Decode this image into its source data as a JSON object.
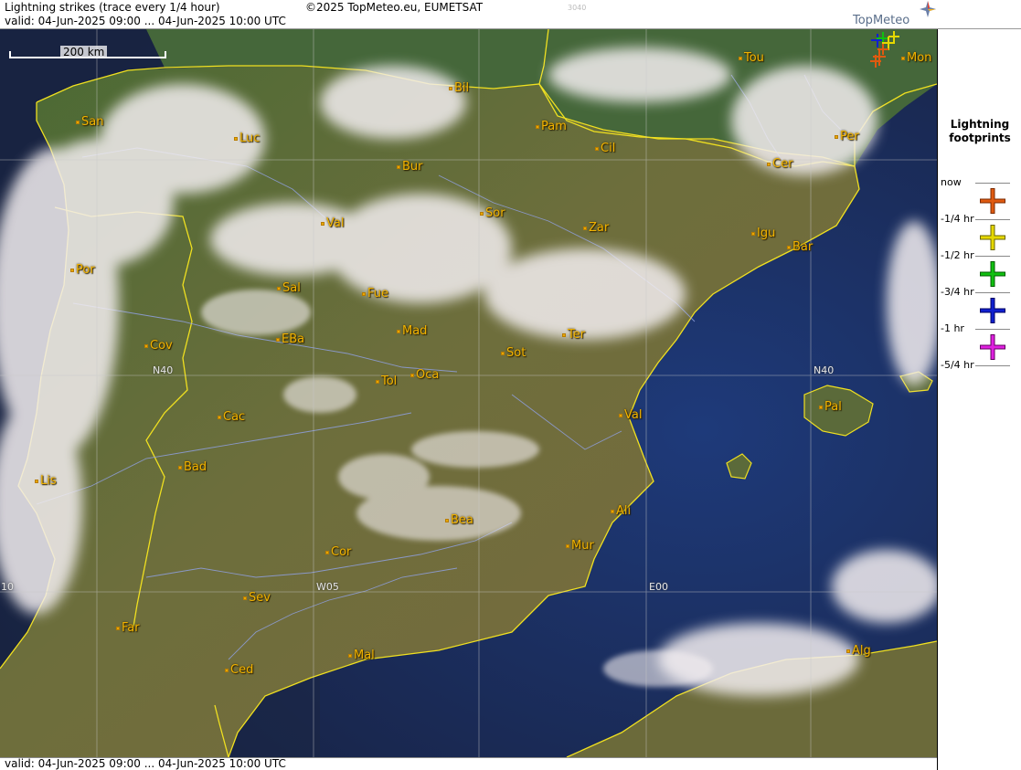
{
  "header": {
    "title": "Lightning strikes (trace every 1/4 hour)",
    "valid": "valid:  04-Jun-2025 09:00 ... 04-Jun-2025 10:00 UTC",
    "copyright": "©2025 TopMeteo.eu, EUMETSAT",
    "code": "3040",
    "logo_text": "TopMeteo"
  },
  "footer": {
    "valid": "valid:  04-Jun-2025 09:00 ... 04-Jun-2025 10:00 UTC"
  },
  "map": {
    "scale_label": "200 km",
    "grid_labels": {
      "n40_left": "N40",
      "n40_right": "N40",
      "w10": "10",
      "w05": "W05",
      "e00": "E00"
    },
    "cities": [
      {
        "name": "Tou"
      },
      {
        "name": "Mon"
      },
      {
        "name": "Bil"
      },
      {
        "name": "San"
      },
      {
        "name": "Pam"
      },
      {
        "name": "Luc"
      },
      {
        "name": "Cil"
      },
      {
        "name": "Per"
      },
      {
        "name": "Bur"
      },
      {
        "name": "Cer"
      },
      {
        "name": "Sor"
      },
      {
        "name": "Val"
      },
      {
        "name": "Zar"
      },
      {
        "name": "Igu"
      },
      {
        "name": "Bar"
      },
      {
        "name": "Por"
      },
      {
        "name": "Sal"
      },
      {
        "name": "Fue"
      },
      {
        "name": "Mad"
      },
      {
        "name": "Ter"
      },
      {
        "name": "Cov"
      },
      {
        "name": "EBa"
      },
      {
        "name": "Sot"
      },
      {
        "name": "Tol"
      },
      {
        "name": "Oca"
      },
      {
        "name": "Pal"
      },
      {
        "name": "Cac"
      },
      {
        "name": "Val"
      },
      {
        "name": "Bad"
      },
      {
        "name": "Lis"
      },
      {
        "name": "Ali"
      },
      {
        "name": "Bea"
      },
      {
        "name": "Mur"
      },
      {
        "name": "Cor"
      },
      {
        "name": "Sev"
      },
      {
        "name": "Far"
      },
      {
        "name": "Alg"
      },
      {
        "name": "Ced"
      },
      {
        "name": "Mal"
      }
    ]
  },
  "legend": {
    "title_line1": "Lightning",
    "title_line2": "footprints",
    "rows": [
      {
        "label": "now",
        "color": "#e05a10"
      },
      {
        "label": "-1/4 hr",
        "color": "#e6d800"
      },
      {
        "label": "-1/2 hr",
        "color": "#10c010"
      },
      {
        "label": "-3/4 hr",
        "color": "#1020d0"
      },
      {
        "label": "-1 hr",
        "color": "#e020e0"
      },
      {
        "label": "-5/4 hr",
        "color": ""
      }
    ]
  },
  "colors": {
    "sea": "#1b2a4a",
    "land": "#5d6b34",
    "border": "#f0e020",
    "city": "#f2b300",
    "river": "#8fa0e0"
  }
}
